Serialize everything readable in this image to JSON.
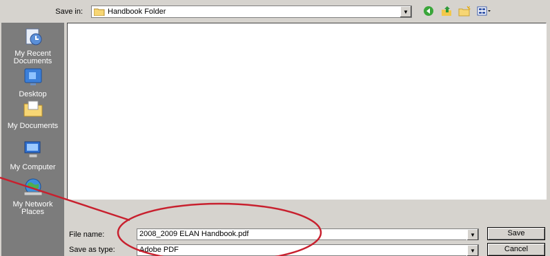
{
  "toolbar": {
    "save_in_label": "Save in:",
    "location": "Handbook Folder",
    "icons": [
      "back-icon",
      "up-folder-icon",
      "new-folder-icon",
      "view-menu-icon"
    ]
  },
  "places": [
    {
      "label": "My Recent Documents",
      "icon": "recent-documents-icon"
    },
    {
      "label": "Desktop",
      "icon": "desktop-icon"
    },
    {
      "label": "My Documents",
      "icon": "my-documents-icon"
    },
    {
      "label": "My Computer",
      "icon": "my-computer-icon"
    },
    {
      "label": "My Network Places",
      "icon": "network-places-icon"
    }
  ],
  "form": {
    "file_name_label": "File name:",
    "file_name_value": "2008_2009 ELAN Handbook.pdf",
    "save_as_type_label": "Save as type:",
    "save_as_type_value": "Adobe PDF",
    "save_button": "Save",
    "cancel_button": "Cancel"
  },
  "colors": {
    "annotation": "#c8202e",
    "dialog_bg": "#d6d3ce",
    "places_bg": "#7c7c7c"
  }
}
